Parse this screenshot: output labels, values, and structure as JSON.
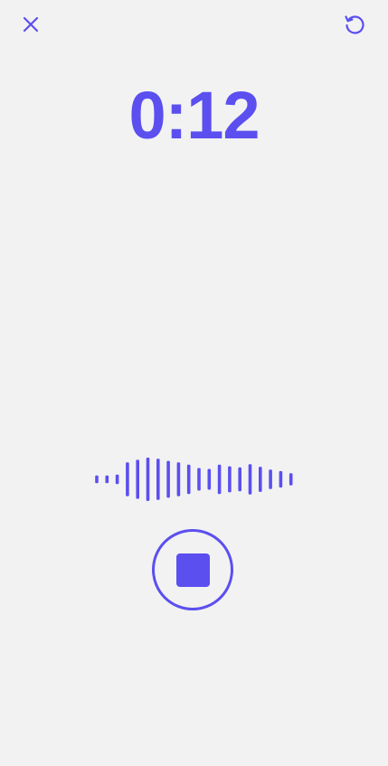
{
  "theme": {
    "accent": "#5b4ff0",
    "background": "#f2f2f2"
  },
  "header": {
    "close_icon": "close-icon",
    "reset_icon": "reset-icon"
  },
  "timer": {
    "elapsed": "0:12"
  },
  "waveform": {
    "levels": [
      0.18,
      0.18,
      0.22,
      0.78,
      0.9,
      1.0,
      0.95,
      0.85,
      0.78,
      0.68,
      0.52,
      0.48,
      0.68,
      0.6,
      0.55,
      0.7,
      0.58,
      0.45,
      0.38,
      0.28
    ]
  },
  "controls": {
    "stop_icon": "stop-icon"
  }
}
